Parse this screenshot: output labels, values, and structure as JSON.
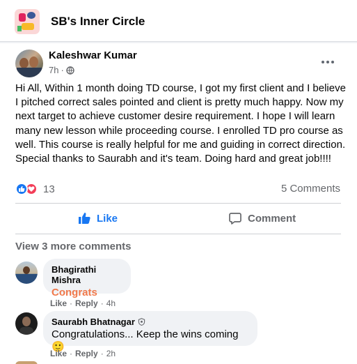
{
  "group": {
    "name": "SB's Inner Circle"
  },
  "post": {
    "author": "Kaleshwar Kumar",
    "time": "7h",
    "separator": "·",
    "paragraph1": "Hi All, Within 1 month doing TD course,  I got my first client and I believe I pitched correct sales pointed and client is pretty much happy. Now my next target to achieve customer desire requirement. I hope I will learn many new lesson while proceeding course. I enrolled TD pro course as well. This course is really helpful for me and guiding in correct direction.",
    "paragraph2": "Special thanks to Saurabh and it's team. Doing hard and great job!!!!",
    "reaction_count": "13",
    "comments_count": "5 Comments"
  },
  "actions": {
    "like": "Like",
    "comment": "Comment"
  },
  "view_more": "View 3 more comments",
  "comments": [
    {
      "author": "Bhagirathi Mishra",
      "text": "Congrats",
      "like": "Like",
      "reply": "Reply",
      "time": "4h",
      "sep": "·"
    },
    {
      "author": "Saurabh Bhatnagar",
      "text": "Congratulations... Keep the wins coming 🙂",
      "like": "Like",
      "reply": "Reply",
      "time": "2h",
      "sep": "·"
    }
  ],
  "colors": {
    "brand_blue": "#1877f2",
    "love_red": "#f33e58",
    "congrats_orange": "#f0784a",
    "muted": "#65676b"
  },
  "icons": [
    "group-avatar",
    "globe-icon",
    "more-icon",
    "like-reaction-icon",
    "love-reaction-icon",
    "like-icon",
    "comment-icon",
    "admin-badge-icon"
  ]
}
